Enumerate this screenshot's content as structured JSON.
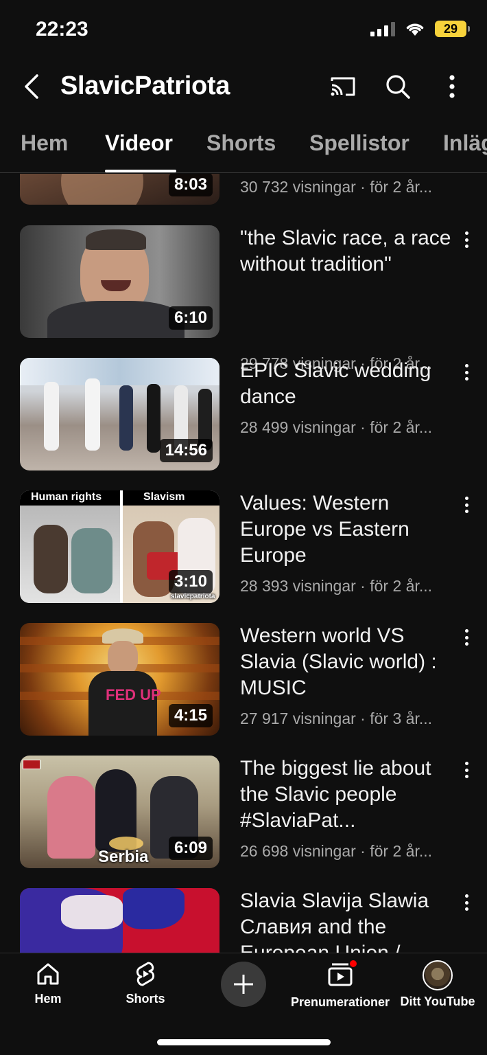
{
  "status_bar": {
    "time": "22:23",
    "battery": "29"
  },
  "header": {
    "channel_name": "SlavicPatriota"
  },
  "tabs": [
    {
      "label": "Hem"
    },
    {
      "label": "Videor"
    },
    {
      "label": "Shorts"
    },
    {
      "label": "Spellistor"
    },
    {
      "label": "Inläg"
    }
  ],
  "videos": [
    {
      "title": "",
      "meta": "30 732 visningar · för 2 år...",
      "duration": "8:03"
    },
    {
      "title": "\"the Slavic race, a race without tradition\"",
      "meta": "29 778 visningar · för 2 år...",
      "duration": "6:10"
    },
    {
      "title": "EPIC Slavic wedding dance",
      "meta": "28 499 visningar · för 2 år...",
      "duration": "14:56"
    },
    {
      "title": "Values: Western Europe vs Eastern Europe",
      "meta": "28 393 visningar · för 2 år...",
      "duration": "3:10",
      "thumb_left": "Human rights",
      "thumb_right": "Slavism",
      "watermark": "slavicpatriota"
    },
    {
      "title": "Western world VS Slavia (Slavic world) : MUSIC",
      "meta": "27 917 visningar · för 3 år...",
      "duration": "4:15",
      "shirt_text": "FED UP"
    },
    {
      "title": "The biggest lie about the Slavic people #SlaviaPat...",
      "meta": "26 698 visningar · för 2 år...",
      "duration": "6:09",
      "caption": "Serbia"
    },
    {
      "title": "Slavia Slavija Slawia Славия and the European Union /",
      "meta": "",
      "duration": ""
    }
  ],
  "bottom_nav": [
    {
      "label": "Hem",
      "icon": "home-icon"
    },
    {
      "label": "Shorts",
      "icon": "shorts-icon"
    },
    {
      "label": "",
      "icon": "create-icon"
    },
    {
      "label": "Prenumerationer",
      "icon": "subscriptions-icon"
    },
    {
      "label": "Ditt YouTube",
      "icon": "avatar"
    }
  ],
  "colors": {
    "background": "#0f0f0f",
    "text": "#f1f1f1",
    "secondary": "#aaaaaa",
    "battery": "#f7d23b",
    "notification": "#ff0000"
  }
}
